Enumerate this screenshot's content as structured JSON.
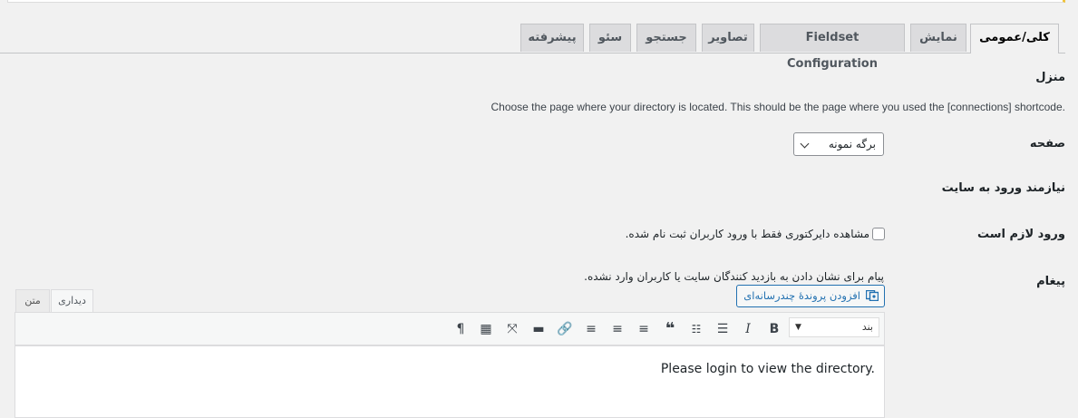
{
  "tabs": [
    {
      "label": "کلی/عمومی",
      "active": true
    },
    {
      "label": "نمایش"
    },
    {
      "label": "Fieldset Configuration"
    },
    {
      "label": "تصاویر"
    },
    {
      "label": "جستجو"
    },
    {
      "label": "سئو"
    },
    {
      "label": "پیشرفته"
    }
  ],
  "home": {
    "title": "منزل",
    "description": "Choose the page where your directory is located. This should be the page where you used the [connections] shortcode."
  },
  "page_field": {
    "label": "صفحه",
    "selected": "برگه نمونه"
  },
  "login_required_section": {
    "title": "نیازمند ورود به سایت"
  },
  "login_field": {
    "label": "ورود لازم است",
    "checkbox_label": "مشاهده دایرکتوری فقط با ورود کاربران ثبت نام شده.",
    "checked": false
  },
  "message_field": {
    "label": "پیغام",
    "description": "پیام برای نشان دادن به بازدید کنندگان سایت یا کاربران وارد نشده.",
    "add_media": "افزودن پروندهٔ چندرسانه‌ای",
    "editor_tabs": {
      "visual": "دیداری",
      "text": "متن"
    },
    "format_select": "بند",
    "content": "Please login to view the directory."
  },
  "toolbar_icons": [
    "bold-icon",
    "italic-icon",
    "bullet-list-icon",
    "numbered-list-icon",
    "blockquote-icon",
    "align-left-icon",
    "align-center-icon",
    "align-right-icon",
    "link-icon",
    "read-more-icon",
    "fullscreen-icon",
    "toolbar-toggle-icon",
    "paragraph-direction-icon"
  ],
  "colors": {
    "accent": "#2271b1",
    "notice": "#f0c33c"
  }
}
